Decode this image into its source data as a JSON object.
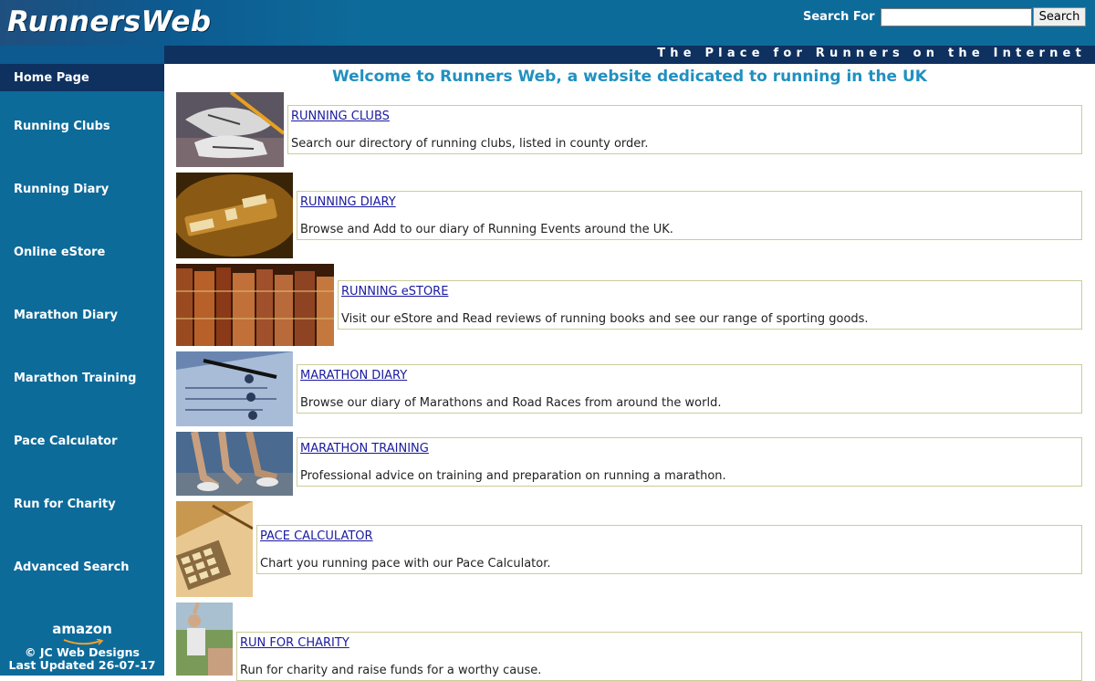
{
  "header": {
    "logo": "RunnersWeb",
    "search_label": "Search For",
    "search_value": "",
    "search_button": "Search",
    "tagline": "The Place for Runners on the Internet"
  },
  "sidebar": {
    "items": [
      {
        "label": "Home Page"
      },
      {
        "label": "Running Clubs"
      },
      {
        "label": "Running Diary"
      },
      {
        "label": "Online eStore"
      },
      {
        "label": "Marathon Diary"
      },
      {
        "label": "Marathon Training"
      },
      {
        "label": "Pace Calculator"
      },
      {
        "label": "Run for Charity"
      },
      {
        "label": "Advanced Search"
      }
    ],
    "amazon": "amazon",
    "copyright": "© JC Web Designs",
    "updated": "Last Updated 26-07-17"
  },
  "main": {
    "welcome": "Welcome to Runners Web, a website dedicated to running in the UK",
    "features": [
      {
        "title": "RUNNING CLUBS",
        "desc": "Search our directory of running clubs, listed in county order.",
        "image": "running-shoes-photo"
      },
      {
        "title": "RUNNING DIARY",
        "desc": "Browse and Add to our diary of Running Events around the UK.",
        "image": "calendar-dial-photo"
      },
      {
        "title": "RUNNING eSTORE",
        "desc": "Visit our eStore and Read reviews of running books and see our range of sporting goods.",
        "image": "books-photo"
      },
      {
        "title": "MARATHON DIARY",
        "desc": "Browse our diary of Marathons and Road Races from around the world.",
        "image": "diary-pen-photo"
      },
      {
        "title": "MARATHON TRAINING",
        "desc": "Professional advice on training and preparation on running a marathon.",
        "image": "runners-legs-photo"
      },
      {
        "title": "PACE CALCULATOR",
        "desc": "Chart you running pace with our Pace Calculator.",
        "image": "calculator-photo"
      },
      {
        "title": "RUN FOR CHARITY",
        "desc": "Run for charity and raise funds for a worthy cause.",
        "image": "charity-runner-photo"
      }
    ]
  },
  "colors": {
    "header_blue": "#0d6b9a",
    "dark_navy": "#0e3160",
    "welcome_blue": "#2190c0",
    "link_blue": "#1a1aa0",
    "box_border": "#cccc99"
  }
}
